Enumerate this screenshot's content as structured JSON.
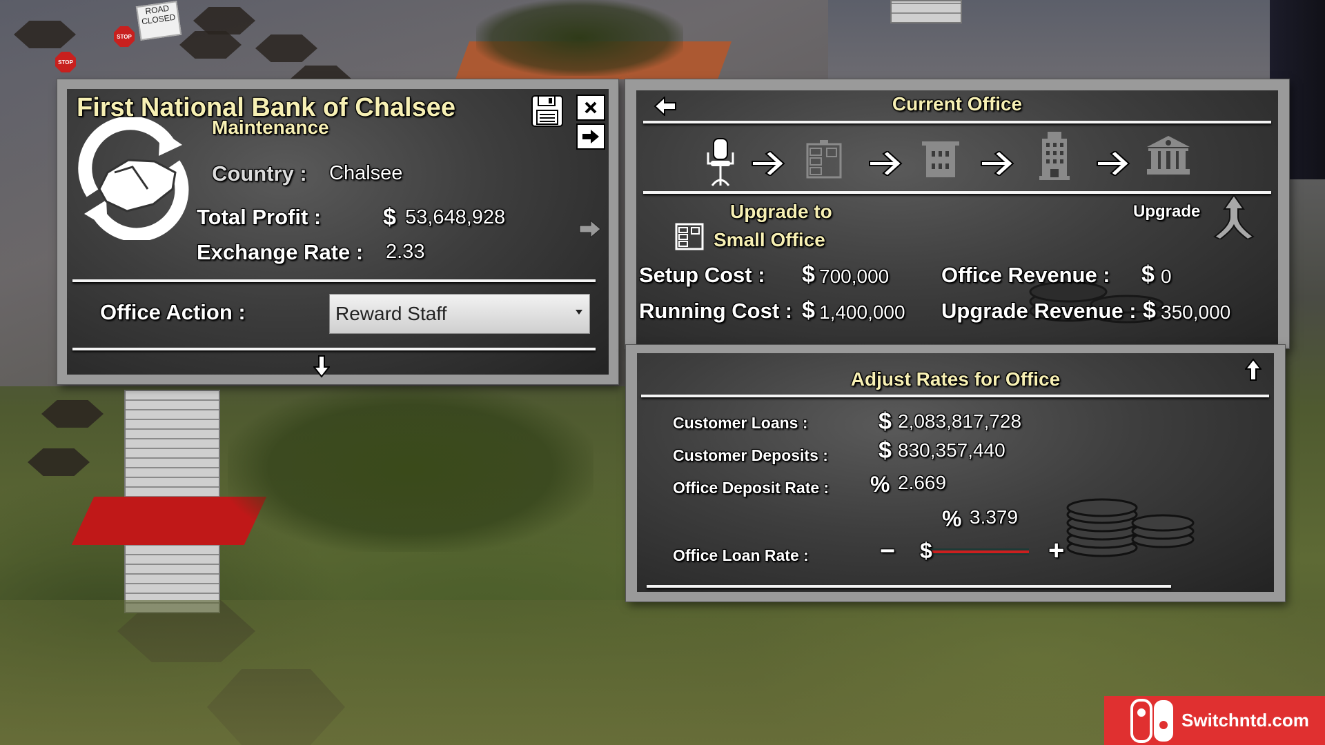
{
  "scene": {
    "road_sign": "ROAD CLOSED",
    "stop_sign": "STOP"
  },
  "bank_panel": {
    "title": "First National Bank of Chalsee",
    "status": "Maintenance",
    "country_label": "Country :",
    "country_value": "Chalsee",
    "total_profit_label": "Total Profit :",
    "total_profit_currency": "$",
    "total_profit_value": "53,648,928",
    "exchange_rate_label": "Exchange Rate :",
    "exchange_rate_value": "2.33",
    "office_action_label": "Office Action :",
    "office_action_selected": "Reward Staff",
    "icons": {
      "logo": "handshake-cycle-icon",
      "save": "save-icon",
      "close": "close-icon",
      "next": "arrow-right-icon",
      "next_office": "arrow-right-icon",
      "collapse": "arrow-down-icon"
    }
  },
  "current_office": {
    "title": "Current Office",
    "upgrade_path": [
      {
        "name": "Desk",
        "icon": "office-chair-icon",
        "state": "current"
      },
      {
        "name": "Small Office",
        "icon": "filing-cabinet-icon",
        "state": "next"
      },
      {
        "name": "Office Building",
        "icon": "building-icon",
        "state": "locked"
      },
      {
        "name": "Tower",
        "icon": "skyscraper-icon",
        "state": "locked"
      },
      {
        "name": "Bank",
        "icon": "bank-icon",
        "state": "locked"
      }
    ],
    "upgrade_to_label": "Upgrade to",
    "upgrade_to_target": "Small Office",
    "upgrade_button_label": "Upgrade",
    "setup_cost_label": "Setup Cost :",
    "setup_cost_value": "700,000",
    "running_cost_label": "Running Cost :",
    "running_cost_value": "1,400,000",
    "office_revenue_label": "Office Revenue :",
    "office_revenue_value": "0",
    "upgrade_revenue_label": "Upgrade Revenue :",
    "upgrade_revenue_value": "350,000",
    "currency": "$"
  },
  "adjust_rates": {
    "title": "Adjust Rates for Office",
    "customer_loans_label": "Customer Loans :",
    "customer_loans_value": "2,083,817,728",
    "customer_deposits_label": "Customer Deposits :",
    "customer_deposits_value": "830,357,440",
    "deposit_rate_label": "Office Deposit Rate :",
    "deposit_rate_value": "2.669",
    "loan_rate_label": "Office Loan Rate :",
    "loan_rate_value": "3.379",
    "loan_rate_slider_position": 0,
    "percent_symbol": "%",
    "currency": "$",
    "minus_label": "−",
    "plus_label": "+",
    "accent_color": "#cc1f1f"
  },
  "watermark": {
    "text": "Switchntd.com",
    "color": "#e03030"
  }
}
